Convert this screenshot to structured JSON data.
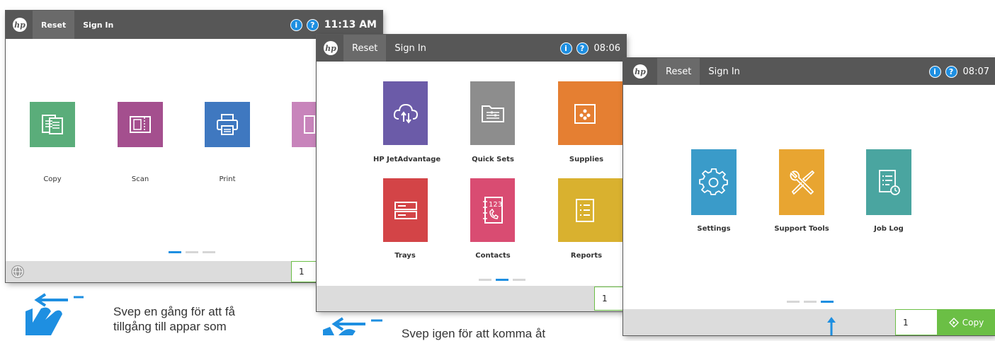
{
  "screens": [
    {
      "logo": "hp",
      "reset_label": "Reset",
      "signin_label": "Sign In",
      "time": "11:13 AM",
      "tiles": [
        {
          "label": "Copy",
          "color": "#5aad7a",
          "icon": "copy-icon"
        },
        {
          "label": "Scan",
          "color": "#a44f8e",
          "icon": "scan-icon"
        },
        {
          "label": "Print",
          "color": "#3f78c0",
          "icon": "print-icon"
        },
        {
          "label": "",
          "color": "#c884bb",
          "icon": "partial-app-icon"
        }
      ],
      "page_indicator": {
        "count": 3,
        "active": 1
      },
      "copies": "1"
    },
    {
      "logo": "hp",
      "reset_label": "Reset",
      "signin_label": "Sign In",
      "time": "08:06",
      "tiles": [
        {
          "label": "HP JetAdvantage",
          "color": "#6b5ba8",
          "icon": "cloud-icon"
        },
        {
          "label": "Quick Sets",
          "color": "#8d8d8d",
          "icon": "quick-sets-icon"
        },
        {
          "label": "Supplies",
          "color": "#e57f32",
          "icon": "supplies-icon"
        },
        {
          "label": "Trays",
          "color": "#d34447",
          "icon": "trays-icon"
        },
        {
          "label": "Contacts",
          "color": "#d94c72",
          "icon": "contacts-icon"
        },
        {
          "label": "Reports",
          "color": "#d9b12f",
          "icon": "reports-icon"
        }
      ],
      "page_indicator": {
        "count": 3,
        "active": 2
      },
      "copies": "1"
    },
    {
      "logo": "hp",
      "reset_label": "Reset",
      "signin_label": "Sign In",
      "time": "08:07",
      "tiles": [
        {
          "label": "Settings",
          "color": "#3a9bc9",
          "icon": "gear-icon"
        },
        {
          "label": "Support Tools",
          "color": "#e8a531",
          "icon": "tools-icon"
        },
        {
          "label": "Job Log",
          "color": "#4aa5a0",
          "icon": "job-log-icon"
        }
      ],
      "page_indicator": {
        "count": 3,
        "active": 3
      },
      "copies": "1",
      "copy_button_label": "Copy"
    }
  ],
  "captions": [
    {
      "line1": "Svep en gång för att få",
      "line2": "tillgång till appar som"
    },
    {
      "line1": "Svep igen för att komma åt"
    }
  ],
  "accent_color": "#1e8fe1",
  "green_color": "#6bbf45"
}
